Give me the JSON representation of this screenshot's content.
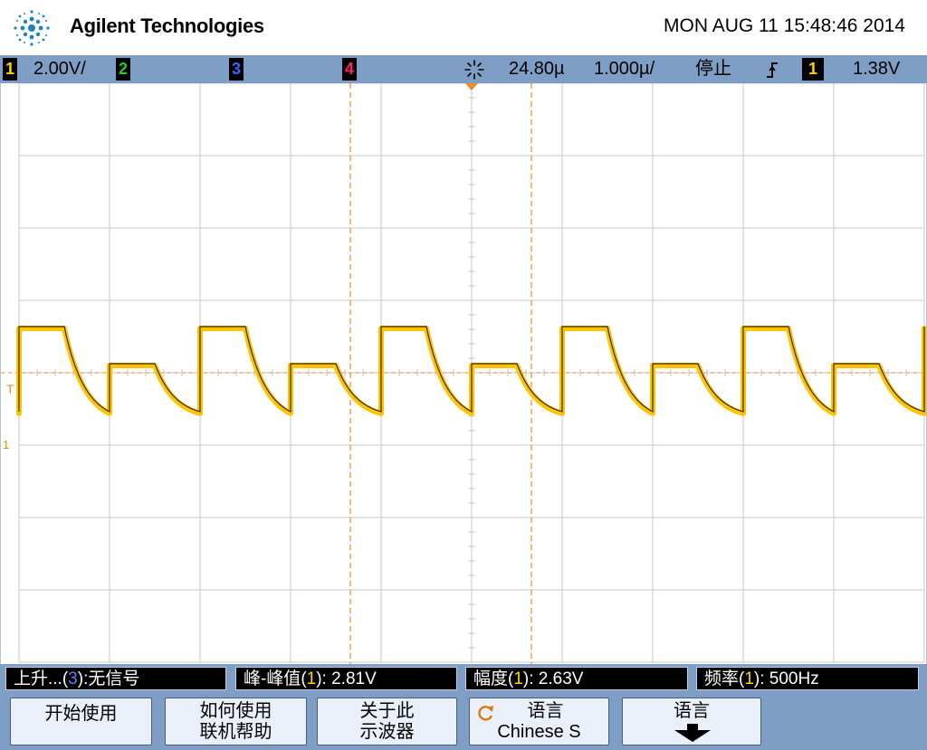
{
  "header": {
    "brand": "Agilent Technologies",
    "datetime": "MON AUG 11 15:48:46 2014"
  },
  "status": {
    "ch1_label": "1",
    "ch1_scale": "2.00V/",
    "ch2_label": "2",
    "ch3_label": "3",
    "ch4_label": "4",
    "trigger_icon": "acquisition-icon",
    "time_delay": "24.80µ",
    "time_scale": "1.000µ/",
    "run_state": "停止",
    "trigger_slope_icon": "rising-edge-icon",
    "trigger_source": "1",
    "trigger_level": "1.38V"
  },
  "markers": {
    "trigger_marker": "T",
    "ground_marker": "1"
  },
  "measurements": [
    {
      "prefix": "上升...(",
      "channel": "3",
      "suffix": "):无信号"
    },
    {
      "prefix": "峰-峰值(",
      "channel": "1",
      "suffix": "): 2.81V"
    },
    {
      "prefix": "幅度(",
      "channel": "1",
      "suffix": "): 2.63V"
    },
    {
      "prefix": "频率(",
      "channel": "1",
      "suffix": "): 500Hz"
    }
  ],
  "softkeys": [
    {
      "line1": "开始使用",
      "line2": ""
    },
    {
      "line1": "如何使用",
      "line2": "联机帮助"
    },
    {
      "line1": "关于此",
      "line2": "示波器"
    },
    {
      "line1": "语言",
      "line2": "Chinese S",
      "icon": "rotate-knob-icon"
    },
    {
      "line1": "语言",
      "line2": "",
      "icon": "down-arrow-icon"
    }
  ],
  "colors": {
    "ch1": "#ffd400",
    "ch2": "#22cc22",
    "ch3": "#3a63ff",
    "ch4": "#ff2266",
    "cursor": "#f08a24",
    "grid": "#c8c8c8",
    "bar": "#7f9ec6"
  }
}
